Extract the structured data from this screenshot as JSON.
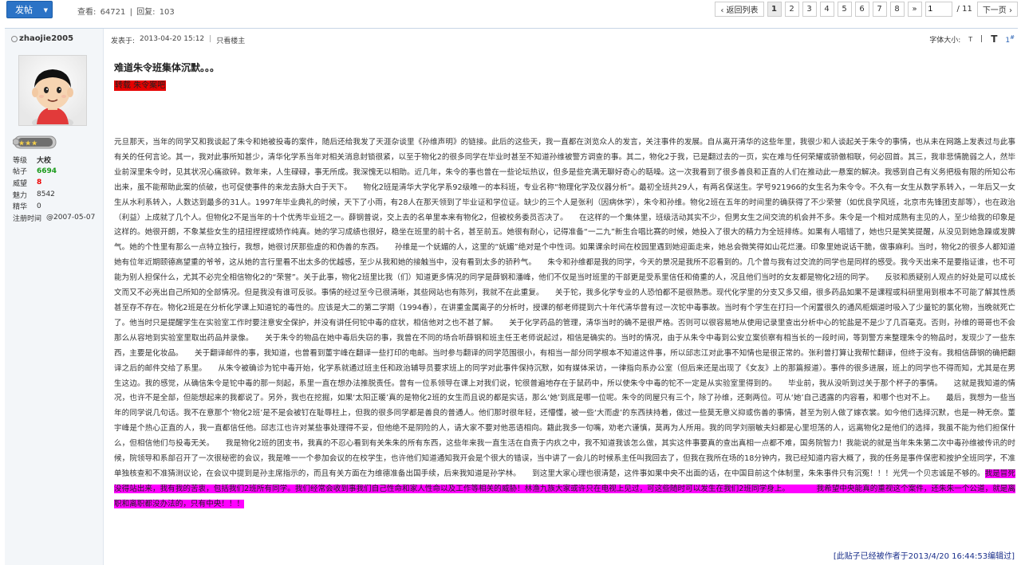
{
  "toolbar": {
    "post_label": "发帖",
    "post_arrow": "▼",
    "views_label": "查看:",
    "views": "64721",
    "divider": "|",
    "replies_label": "回复:",
    "replies": "103"
  },
  "pager": {
    "back_label": "‹ 返回列表",
    "pages": [
      "1",
      "2",
      "3",
      "4",
      "5",
      "6",
      "7",
      "8"
    ],
    "current": "1",
    "more_label": "»",
    "jump_value": "1",
    "total": "/ 11",
    "next_label": "下一页 ›"
  },
  "author": {
    "name": "zhaojie2005",
    "avatar_icon": "cartoon-avatar-icon",
    "rank_icon": "rank-stars-icon",
    "stats": [
      {
        "k": "等级",
        "v": "大校",
        "style": "bold"
      },
      {
        "k": "帖子",
        "v": "6694",
        "style": "green"
      },
      {
        "k": "威望",
        "v": "8",
        "style": "red"
      },
      {
        "k": "魅力",
        "v": "8542",
        "style": ""
      },
      {
        "k": "精华",
        "v": "0",
        "style": ""
      }
    ],
    "reg_label": "注册时间",
    "reg_value": "@2007-05-07"
  },
  "post": {
    "posted_label": "发表于:",
    "posted_time": "2013-04-20 15:12",
    "sep": "|",
    "only_author": "只看楼主",
    "font_size_label": "字体大小:",
    "font_small": "T",
    "font_sep": "|",
    "font_large": "T",
    "floor": "1",
    "floor_sup": "#",
    "title": "难道朱令班集体沉默。。。",
    "tag": "转载 朱令案吧",
    "body": "元旦那天，当年的同学又和我谈起了朱令和她被投毒的案件，随后还给我发了天涯杂谈里《孙维声明》的链接。此后的这些天，我一直都在浏览众人的发言，关注事件的发展。自从离开清华的这些年里，我很少和人谈起关于朱令的事情，也从未在网路上发表过与此事有关的任何言论。其一，我对此事所知甚少，清华化学系当年对相关消息封锁很紧，以至于物化2的很多同学在毕业时甚至不知道孙维被警方调查的事。其二，物化2于我，已是翻过去的一页，实在难与任何荣耀或骄傲相联，何必回首。其三，我非悲情脆弱之人，然毕业前深里朱令时，见其状况心痛欲碎。数年来，人生碌碌，事无所成。我深愧无以相助。近几年，朱令的事也曾在一些论坛热议，但多是些充满无聊好奇心的聒噪。这一次我看到了很多善良和正直的人们在推动此一悬案的解决。我感到自己有义务把极有限的所知公布出来，虽不能帮助此案的侦破，也可促使事件的来龙去脉大白于天下。　　物化2班是清华大学化学系92级唯一的本科班，专业名称“物理化学及仪器分析”。最初全班共29人，有两名保送生。学号921966的女生名为朱令令。不久有一女生从数学系转入，一年后又一女生从水利系转入，人数达到最多的31人。1997年毕业典礼的时候，天下了小雨，有28人在那天领到了毕业证和学位证。缺少的三个人是张利（因病休学），朱令和孙维。物化2班在五年的时间里的确获得了不少荣誉（如优良学风班，北京市先锋团支部等），也在政治（利益）上成就了几个人。但物化2不是当年的十个优秀毕业班之一。薛钢普说，交上去的名单里本来有物化2，但被校务委员否决了。　　在这样的一个集体里，班级活动其实不少，但男女生之间交流的机会并不多。朱令是一个相对成熟有主见的人，至少给我的印象是这样的。她很开朗，不象某些女生的扭扭捏捏或矫作纯真。她的学习成绩也很好，稳坐在班里的前十名，甚至前五。她很有耐心，记得准备“一二九”新生合唱比赛的时候，她投入了很大的精力为全班排练。如果有人唱错了，她也只是笑笑提醒，从没见到她急躁或发脾气。她的个性里有那么一点特立独行，我想，她很讨厌那些虚的和伪善的东西。　　孙维是一个妩媚的人，这里的“妩媚”绝对是个中性词。如果课余时间在校园里遇到她迎面走来，她总会微笑得如山花烂漫。印象里她说话干脆，做事麻利。当时，物化2的很多人都知道她有位年近期颐德高望重的爷爷，这从她的言行里看不出太多的优越感，至少从我和她的接触当中，没有看到太多的骄矜气。　　朱令和孙维都是我的同学，今天的景况是我所不忍看到的。几个曾与我有过交流的同学也是同样的感受。我今天出来不是要指证谁，也不可能为别人担保什么，尤其不必完全相信物化2的“荣誉”。关于此事，物化2班里比我（们）知道更多情况的同学是薛钢和潘峰，他们不仅是当时班里的干部更是受系里信任和倚重的人，况且他们当时的女友都是物化2班的同学。　　反驳和质疑别人观点的好处是可以成长文而又不必亮出自己所知的全部情况。但是我没有谁可反驳。事情的经过至今已很清晰，其些网站也有陈列，我就不在此重复。　　关于铊，我多化学专业的人恐怕都不是很熟悉。现代化学里的分支又多又细，很多药品如果不是课程或科研里用到根本不可能了解其性质甚至存不存在。物化2班是在分析化学课上知道铊的毒性的。应该是大二的第二学期（1994春），在讲重金属离子的分析时，授课的郁老师提到六十年代清华曾有过一次铊中毒事故。当时有个学生在打扫一个闲置很久的通风柜烟道时吸入了少量铊的氯化物，当晚就死亡了。他当时只是提醒学生在实验室工作时要注意安全保护，并没有讲任何铊中毒的症状，相信他对之也不甚了解。　　关于化学药品的管理，清华当时的确不是很严格。否则可以很容易地从使用记录里查出分析中心的铊盐是不是少了几百毫克。否则，孙维的哥哥也不会那么从容地到实验室里取出药品并录像。　　关于朱令的物品在她中毒后失窃的事，我曾在不同的场合听薛钢和班主任王老师说起过，相信是确实的。当时的情况，由于从朱令中毒到公安立案侦察有相当长的一段时间，等到警方来整理朱令的物品时，发现少了一些东西，主要是化妆品。　　关于翻译邮件的事，我知道，也曾看到董宇峰在翻译一些打印的电邮。当时参与翻译的同学范围很小，有相当一部分同学根本不知道这件事，所以邱志江对此事不知情也是很正常的。张利曾打算让我帮忙翻译，但终于没有。我相信薛钢的确把翻译之后的邮件交给了系里。　　从朱令被确诊为铊中毒开始，化学系就通过班主任和政治辅导员要求班上的同学对此事件保持沉默，如有媒体采访，一律指向系办公室（但后来还是出现了《女友》上的那篇报道）。事件的很多进展，班上的同学也不得而知，尤其是在男生这边。我的感觉，从确信朱令是铊中毒的那一刻起，系里一直在想办法推脱责任。曾有一位系领导在课上对我们说，铊很普遍地存在于鼠药中，所以使朱令中毒的铊不一定是从实验室里得到的。　　毕业前，我从没听到过关于那个杯子的事情。　　这就是我知道的情况，也许不是全部，但能想起来的我都说了。另外，我也在挖掘，如果‘太阳正暖’真的是物化2班的女生而且说的都是实话，那么‘她’到底是哪一位呢。朱令的同屋只有三个，除了孙维，还剩两位。可从‘她’自己透露的内容看，和哪个也对不上。　　最后，我想为一些当年的同学说几句话。我不在意那个‘物化2班’是不是会被钉在耻辱柱上，但我的很多同学都是善良的普通人。他们那时很年轻，还懵懂，被一些‘大而虚’的东西挟持着，做过一些莫无意义抑或伤善的事情，甚至为别人做了嫁衣裳。如今他们选择沉默，也是一种无奈。董宇峰是个热心正直的人，我一直都信任他。邱志江也许对某些事处理得不妥，但他绝不是阴险的人，请大家不要对他恶语相向。籍此我多一句嘴，劝老六谨慎，莫再为人所用。我的同学刘丽敏夫妇都是心里坦荡的人，远离物化2是他们的选择，我虽不能为他们担保什么，但相信他们与投毒无关。　　我是物化2班的团支书，我真的不忍心看到有关朱朱的所有东西，这些年来我一直生活在自责于内疚之中，我不知道我该怎么做，其实这件事要真的查出真相一点都不难，国务院智力！我能说的就是当年朱朱第二次中毒孙维被传讯的时候，院领导和系部召开了一次很秘密的会议，我是唯一一个参加会议的在校学生，也许他们知道通知我开会是个很大的错误，当中讲了一会儿的时候系主任叫我回去了，但我在我所在场的18分钟内，我已经知道内容大概了，我的任务是事件保密和按护全班同学，不准单独核查和不准猜测议论，在会议中提到是孙主席指示的，而且有关方面在为维德准备出国手续，后来我知道是孙学林。　　到这里大家心理也很清楚，这件事如果中央不出面的话，在中国目前这个体制里，朱朱事件只有沉冤！！！光凭一个贝志诚是不够的。",
    "highlight": "我是冒死没得站出来，我有我的苦衷，包括我们2班所有同学。我们经常会收到事我们自己性命和家人性命以及工作等相关的威胁！林渔九族大家或许只在电视上见过，可这些随时可以发生在我们2班同学身上。　　　　我希望中央能真的重视这个案件，还朱朱一个公道，就是离职和离职都没办法的，只有中央！！！",
    "edit_note": "[此贴子已经被作者于2013/4/20 16:44:53编辑过]"
  }
}
